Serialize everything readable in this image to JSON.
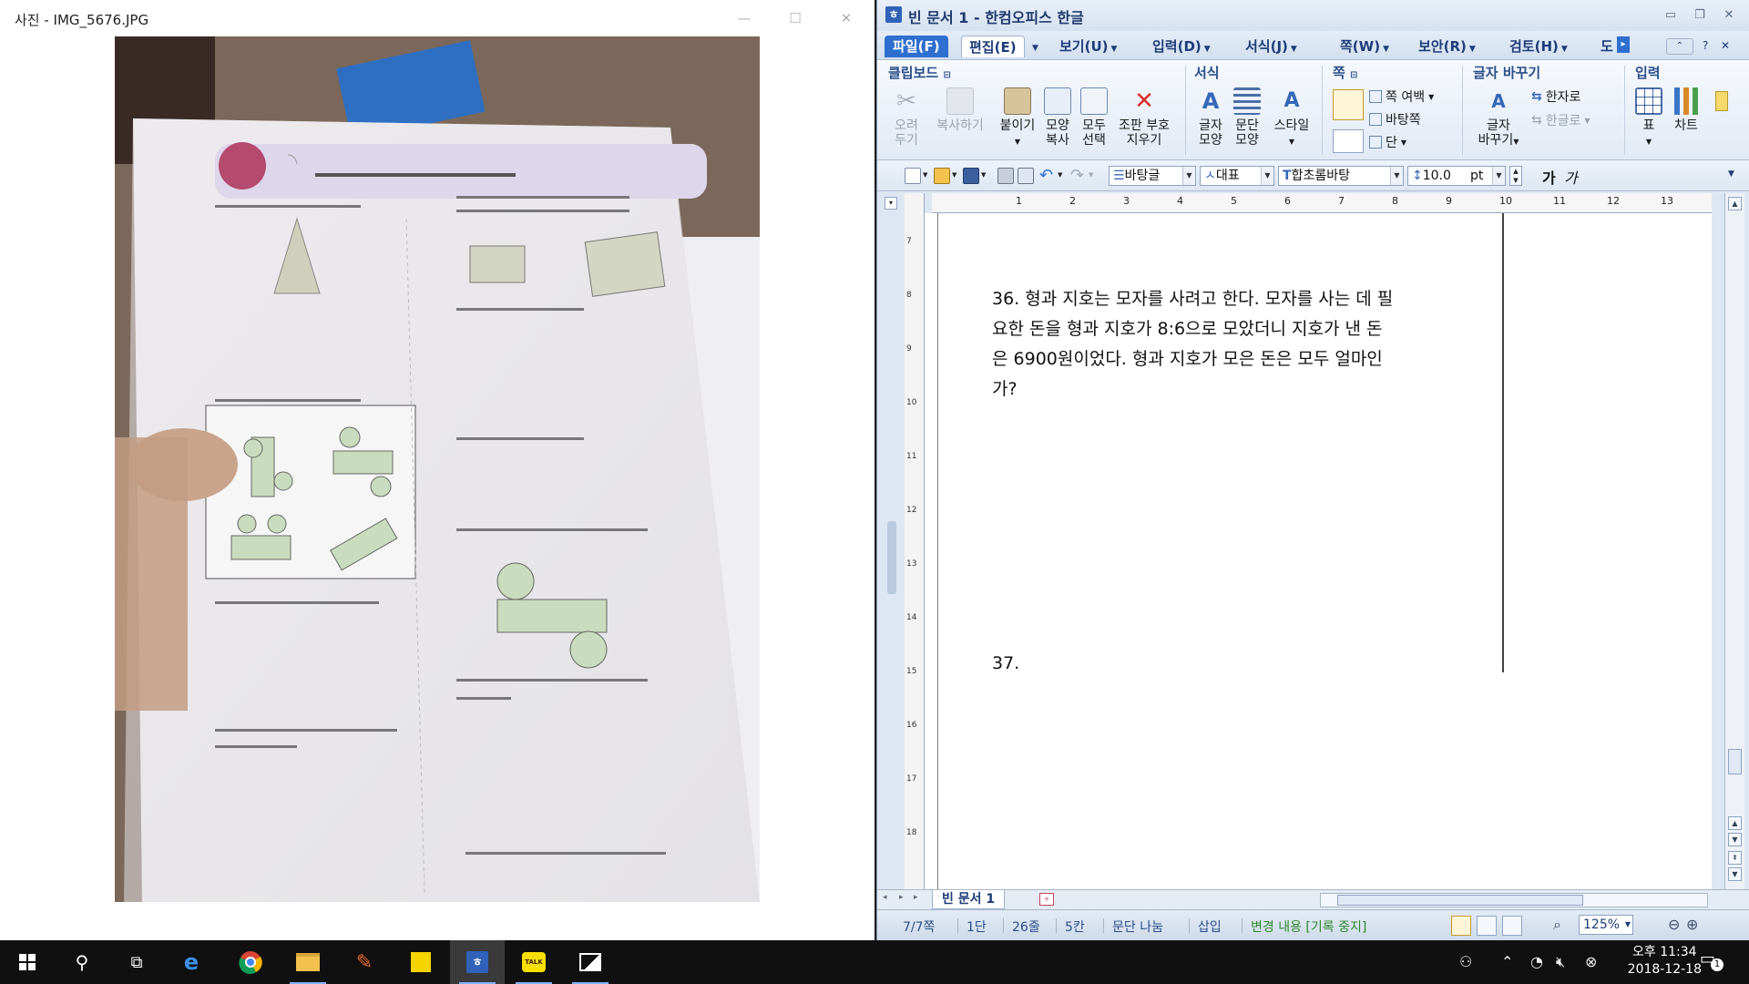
{
  "photos": {
    "title": "사진 - IMG_5676.JPG"
  },
  "hwp": {
    "title": "빈 문서 1 - 한컴오피스 한글",
    "menus": {
      "file": "파일(F)",
      "edit": "편집(E)",
      "view": "보기(U)",
      "insert": "입력(D)",
      "format": "서식(J)",
      "page": "쪽(W)",
      "security": "보안(R)",
      "review": "검토(H)",
      "tools": "도"
    },
    "ribbon": {
      "clipboard_title": "클립보드",
      "cut": "오려\n두기",
      "copy": "복사하기",
      "paste": "붙이기",
      "format_copy": "모양\n복사",
      "select_all": "모두\n선택",
      "clear_format": "조판 부호\n지우기",
      "format_title": "서식",
      "char_shape": "글자\n모양",
      "para_shape": "문단\n모양",
      "style": "스타일",
      "page_title": "쪽",
      "page_margin": "쪽 여백",
      "background": "바탕쪽",
      "columns": "단",
      "replace_title": "글자 바꾸기",
      "char_replace": "글자\n바꾸기",
      "to_hanja": "한자로",
      "to_hangul": "한글로",
      "input_title": "입력",
      "table": "표",
      "chart": "차트"
    },
    "toolbar": {
      "style": "바탕글",
      "lang": "대표",
      "font": "합초롬바탕",
      "size": "10.0",
      "unit": "pt",
      "bold": "가",
      "italic": "가"
    },
    "ruler": {
      "h_ticks": [
        "1",
        "2",
        "3",
        "4",
        "5",
        "6",
        "7",
        "8",
        "9",
        "10",
        "11",
        "12",
        "13"
      ],
      "v_ticks": [
        "7",
        "8",
        "9",
        "10",
        "11",
        "12",
        "13",
        "14",
        "15",
        "16",
        "17",
        "18"
      ]
    },
    "doc": {
      "q36_lines": [
        "36. 형과 지호는 모자를 사려고 한다. 모자를 사는 데 필",
        "요한 돈을 형과 지호가 8:6으로 모았더니 지호가 낸 돈",
        "은 6900원이었다. 형과 지호가 모은 돈은 모두 얼마인",
        "가?"
      ],
      "q37": "37."
    },
    "tab_label": "빈 문서 1",
    "status": {
      "page": "7/7쪽",
      "column": "1단",
      "line": "26줄",
      "col": "5칸",
      "para_split": "문단 나눔",
      "insert": "삽입",
      "track": "변경 내용 [기록 중지]",
      "zoom": "125%"
    }
  },
  "taskbar": {
    "time": "오후 11:34",
    "date": "2018-12-18",
    "notif_count": "1"
  }
}
